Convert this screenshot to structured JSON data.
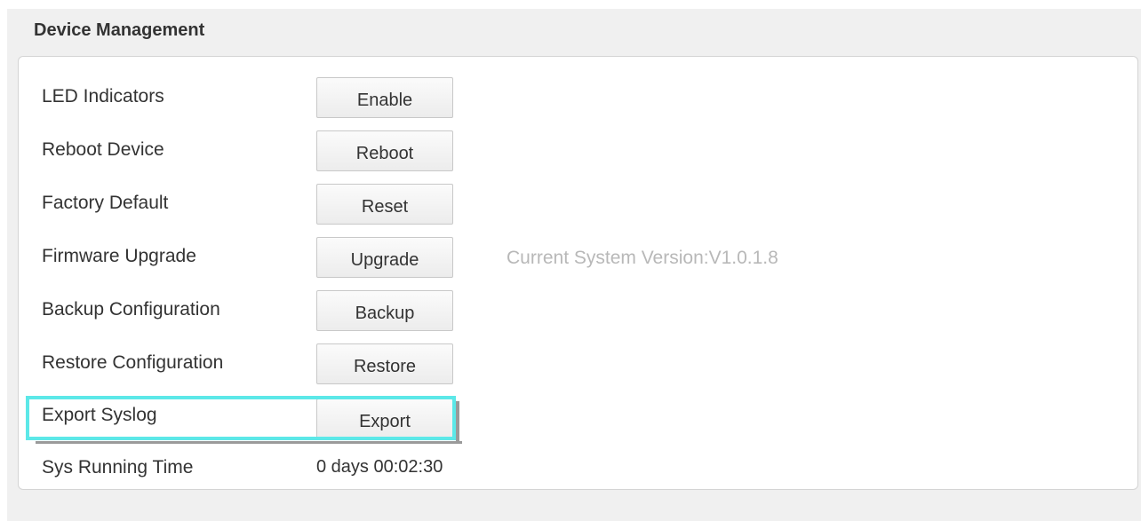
{
  "section": {
    "title": "Device Management"
  },
  "rows": [
    {
      "label": "LED Indicators",
      "button": "Enable"
    },
    {
      "label": "Reboot Device",
      "button": "Reboot"
    },
    {
      "label": "Factory Default",
      "button": "Reset"
    },
    {
      "label": "Firmware Upgrade",
      "button": "Upgrade"
    },
    {
      "label": "Backup Configuration",
      "button": "Backup"
    },
    {
      "label": "Restore Configuration",
      "button": "Restore"
    },
    {
      "label": "Export Syslog",
      "button": "Export"
    }
  ],
  "firmware": {
    "current_version": "Current System Version:V1.0.1.8"
  },
  "running_time": {
    "label": "Sys Running Time",
    "value": "0 days 00:02:30"
  },
  "colors": {
    "highlight": "#5ce8e8",
    "version_text": "#b8b8b8",
    "panel_background": "#f0f0f0"
  }
}
